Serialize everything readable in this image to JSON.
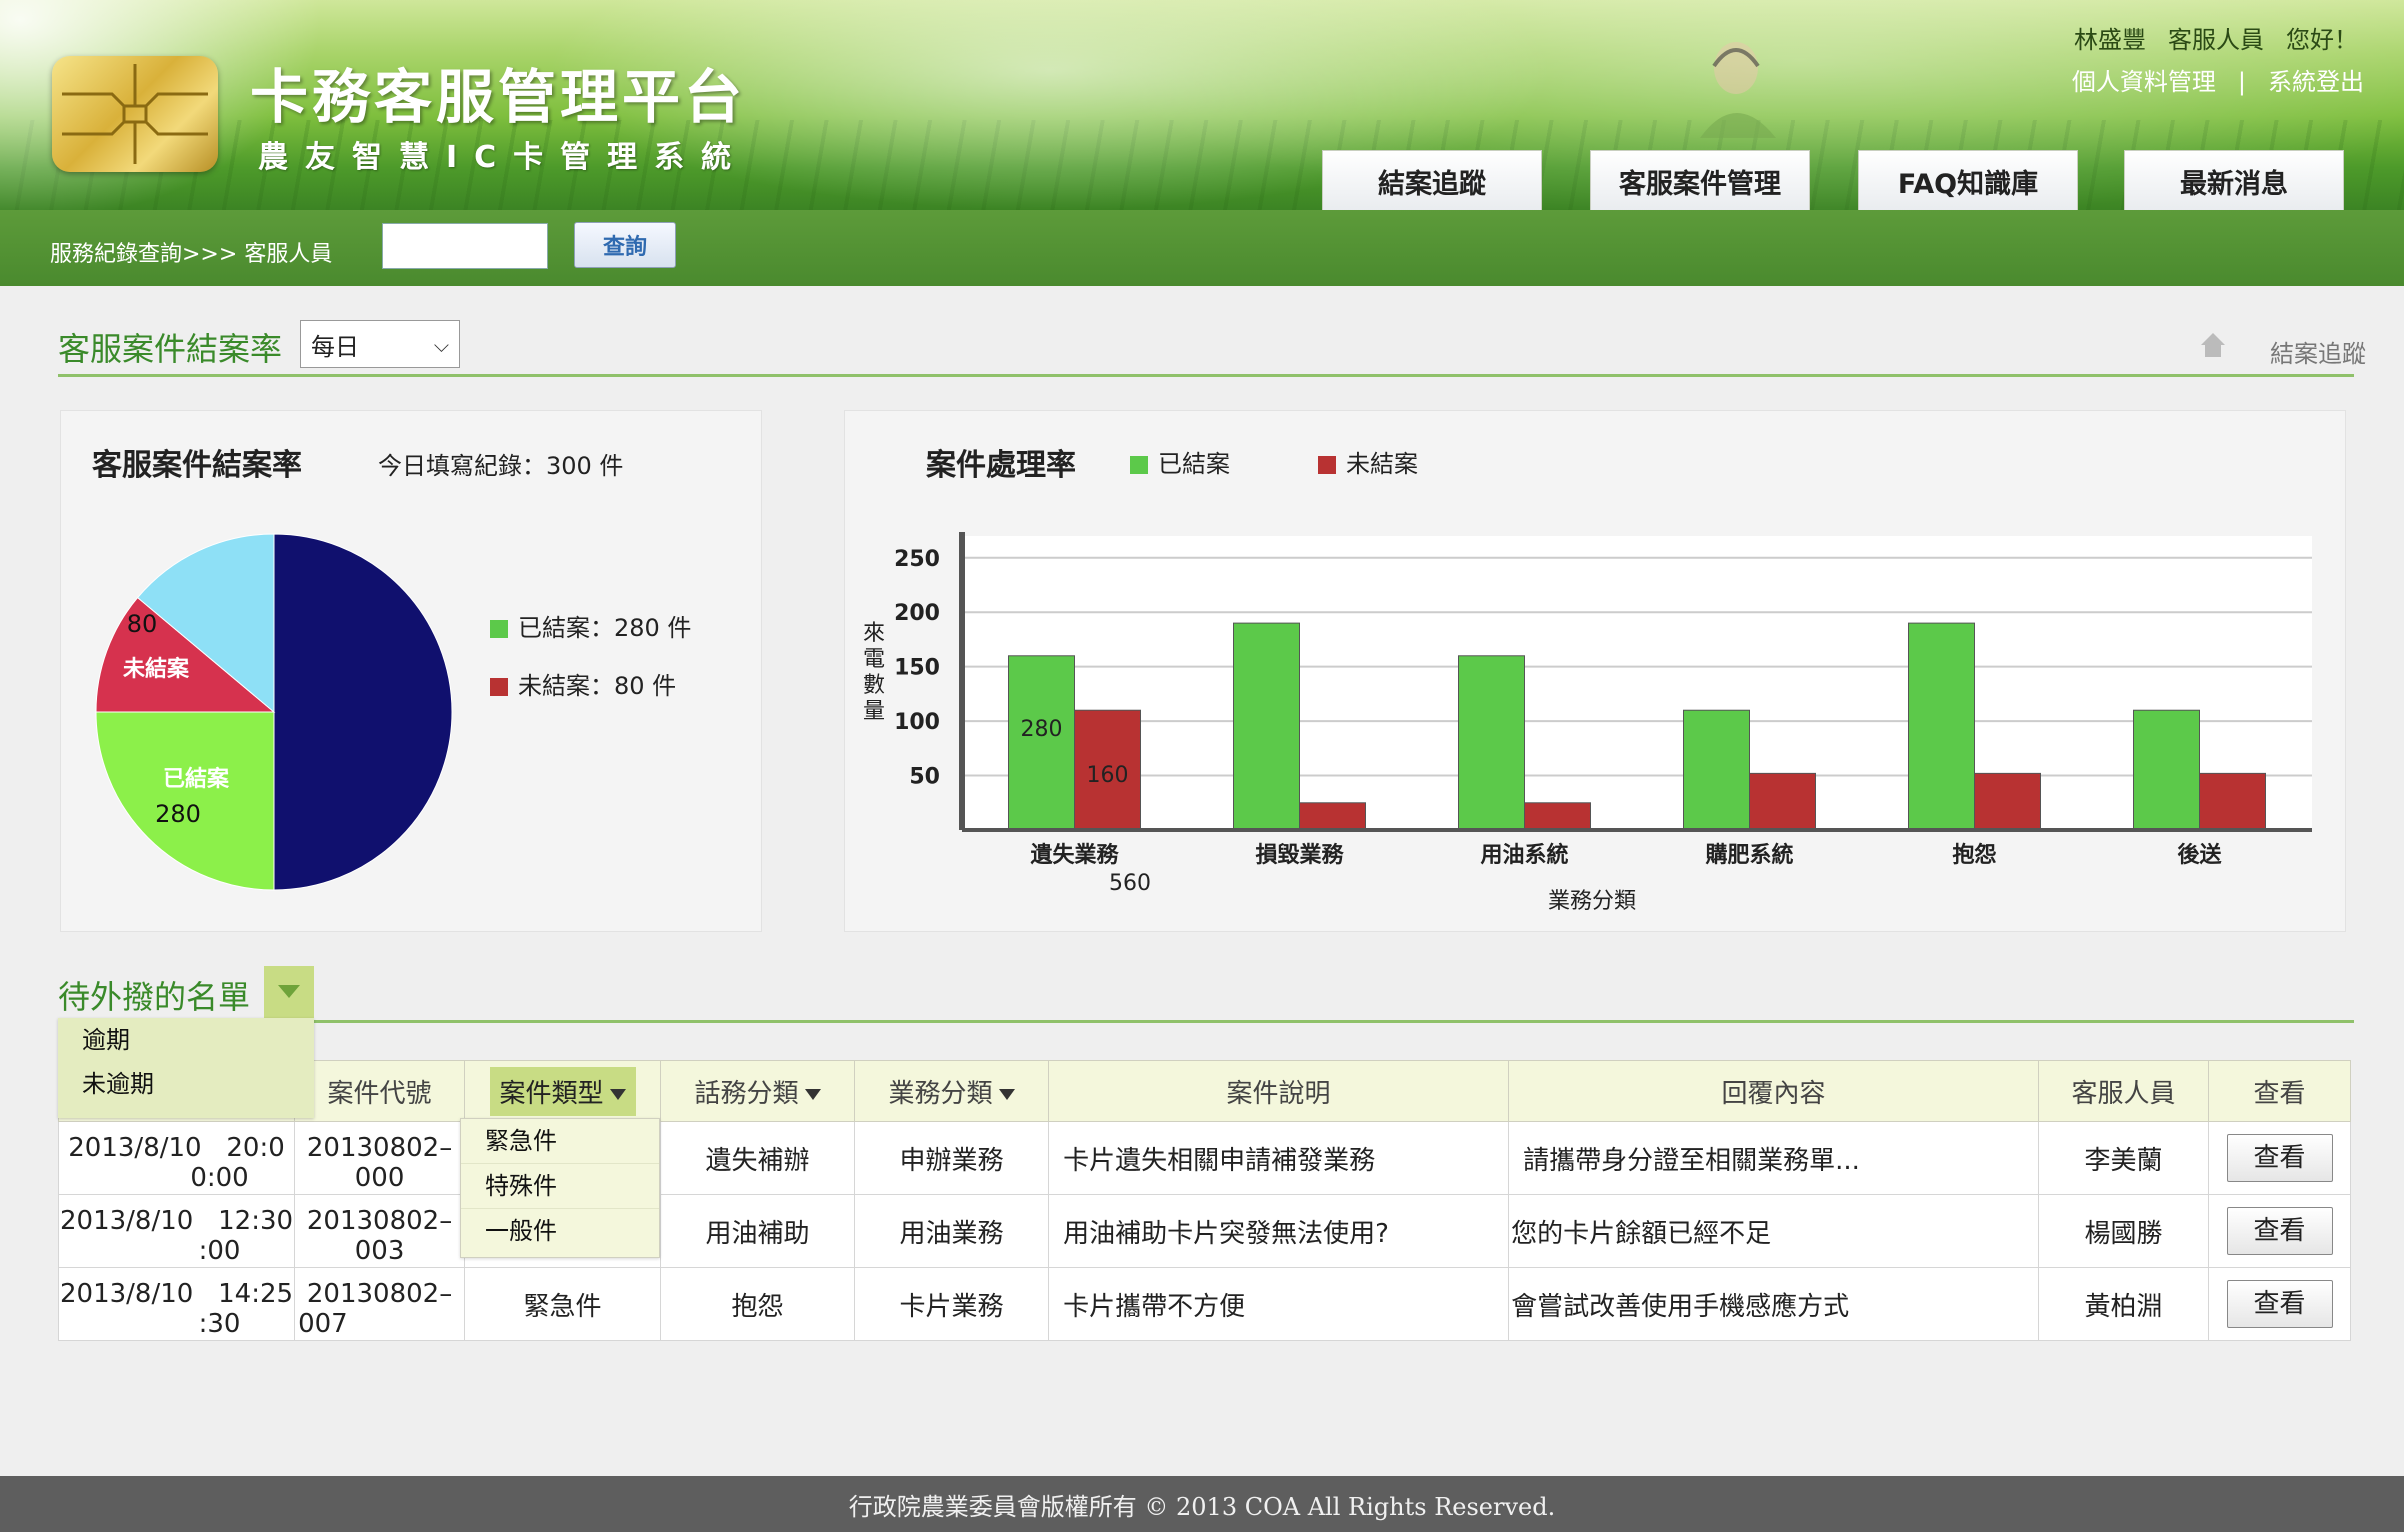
{
  "header": {
    "title": "卡務客服管理平台",
    "subtitle": "農友智慧IC卡管理系統",
    "user_name": "林盛豐",
    "user_role": "客服人員",
    "greeting": "您好！",
    "profile_link": "個人資料管理",
    "separator": "|",
    "logout_link": "系統登出",
    "tabs": [
      {
        "label": "結案追蹤"
      },
      {
        "label": "客服案件管理"
      },
      {
        "label": "FAQ知識庫"
      },
      {
        "label": "最新消息"
      }
    ]
  },
  "subbar": {
    "breadcrumb": "服務紀錄查詢>>>",
    "field_label": "客服人員",
    "input_value": "",
    "search_button": "查詢"
  },
  "section_rate": {
    "title": "客服案件結案率",
    "period_selected": "每日",
    "breadcrumb_right": "結案追蹤"
  },
  "pie_panel": {
    "title": "客服案件結案率",
    "today_records": "今日填寫紀錄：300 件",
    "legend": [
      {
        "label": "已結案：280 件",
        "color": "#5cc94a"
      },
      {
        "label": "未結案：80 件",
        "color": "#b83232"
      }
    ],
    "labels": {
      "closed_name": "已結案",
      "closed_value": "280",
      "open_name": "未結案",
      "open_value": "80"
    }
  },
  "chart_data": [
    {
      "type": "pie",
      "title": "客服案件結案率",
      "slices": [
        {
          "label": "",
          "value": 180,
          "color": "#10106e"
        },
        {
          "label": "已結案",
          "value": 90,
          "color": "#8cf04a"
        },
        {
          "label": "未結案",
          "value": 40,
          "color": "#d6324e"
        },
        {
          "label": "",
          "value": 50,
          "color": "#8ee0f6"
        }
      ]
    },
    {
      "type": "bar",
      "title": "案件處理率",
      "categories": [
        "遺失業務",
        "損毀業務",
        "用油系統",
        "購肥系統",
        "抱怨",
        "後送"
      ],
      "series": [
        {
          "name": "已結案",
          "color": "#5cc94a",
          "values": [
            160,
            190,
            160,
            110,
            190,
            110
          ]
        },
        {
          "name": "未結案",
          "color": "#b83232",
          "values": [
            110,
            25,
            25,
            52,
            52,
            52
          ]
        }
      ],
      "data_labels": {
        "closed_first": "280",
        "open_first": "160",
        "category_first_extra": "560"
      },
      "xlabel": "業務分類",
      "ylabel": "來電數量",
      "yticks": [
        50,
        100,
        150,
        200,
        250
      ],
      "ylim": [
        0,
        270
      ],
      "grid": true,
      "legend": "top"
    }
  ],
  "bar_panel": {
    "title": "案件處理率",
    "legend": [
      {
        "label": "已結案",
        "color": "#5cc94a"
      },
      {
        "label": "未結案",
        "color": "#b83232"
      }
    ],
    "ylabel_chars": [
      "來",
      "電",
      "數",
      "量"
    ],
    "xlabel": "業務分類",
    "extra_label": "560"
  },
  "pending": {
    "title": "待外撥的名單",
    "menu": [
      {
        "label": "逾期"
      },
      {
        "label": "未逾期"
      }
    ],
    "type_menu": [
      {
        "label": "緊急件"
      },
      {
        "label": "特殊件"
      },
      {
        "label": "一般件"
      }
    ],
    "columns": [
      "案件代號",
      "案件類型",
      "話務分類",
      "業務分類",
      "案件說明",
      "回覆內容",
      "客服人員",
      "查看"
    ],
    "rows": [
      {
        "date": "2013/8/10",
        "time": "20:0",
        "time2": "0:00",
        "code": "20130802–",
        "code2": "000",
        "type": "",
        "call": "遺失補辦",
        "biz": "申辦業務",
        "desc": "卡片遺失相關申請補發業務",
        "reply": "請攜帶身分證至相關業務單...",
        "agent": "李美蘭",
        "view": "查看"
      },
      {
        "date": "2013/8/10",
        "time": "12:30",
        "time2": ":00",
        "code": "20130802–",
        "code2": "003",
        "type": "",
        "call": "用油補助",
        "biz": "用油業務",
        "desc": "用油補助卡片突發無法使用?",
        "reply": "您的卡片餘額已經不足",
        "agent": "楊國勝",
        "view": "查看"
      },
      {
        "date": "2013/8/10",
        "time": "14:25",
        "time2": ":30",
        "code": "20130802–",
        "code2": "007",
        "type": "緊急件",
        "call": "抱怨",
        "biz": "卡片業務",
        "desc": "卡片攜帶不方便",
        "reply": "會嘗試改善使用手機感應方式",
        "agent": "黃柏淵",
        "view": "查看"
      }
    ]
  },
  "footer": {
    "text": "行政院農業委員會版權所有 © 2013 COA All Rights Reserved."
  }
}
